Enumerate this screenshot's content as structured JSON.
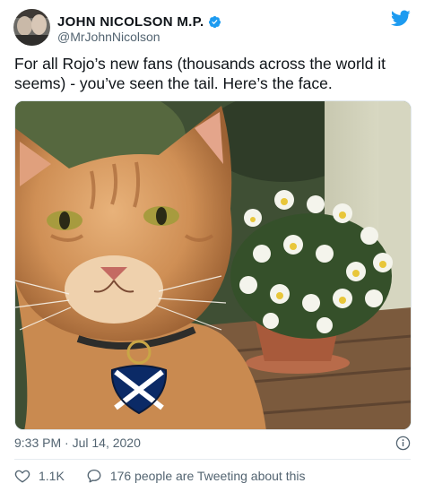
{
  "tweet": {
    "author": {
      "display_name": "JOHN NICOLSON M.P.",
      "handle": "@MrJohnNicolson",
      "verified": true
    },
    "text": "For all Rojo’s new fans (thousands across the world it seems) - you’ve seen the tail. Here’s the face.",
    "media": {
      "alt": "Orange tabby cat with a saltire tag next to a pot of white pansies"
    },
    "timestamp": "9:33 PM · Jul 14, 2020",
    "likes": "1.1K",
    "conversation_label": "176 people are Tweeting about this"
  },
  "colors": {
    "twitter_blue": "#1d9bf0",
    "text_primary": "#0f1419",
    "text_secondary": "#536471"
  },
  "icons": [
    "twitter-bird-icon",
    "verified-badge-icon",
    "info-icon",
    "heart-icon",
    "conversation-icon"
  ]
}
